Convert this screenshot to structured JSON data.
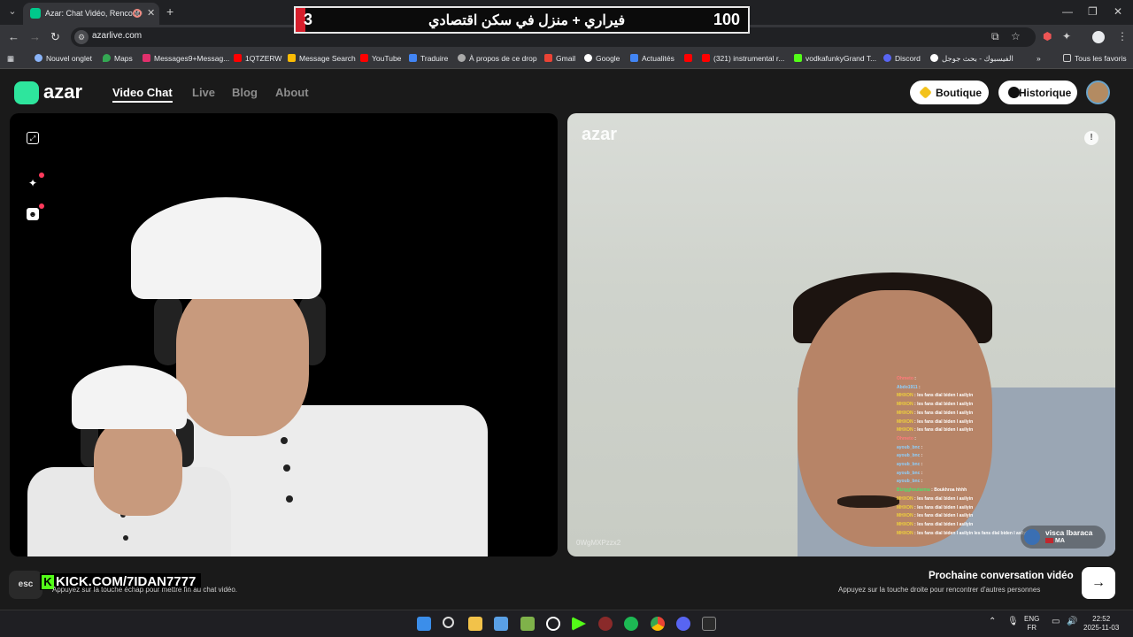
{
  "browser": {
    "tab_title": "Azar: Chat Vidéo, Rencontre",
    "url": "azarlive.com",
    "bookmarks": [
      "Nouvel onglet",
      "Maps",
      "Messages9+Messag...",
      "1QTZERW",
      "Message Search",
      "YouTube",
      "Traduire",
      "À propos de ce drop",
      "Gmail",
      "Google",
      "Actualités",
      "(321) instrumental r...",
      "vodkafunkyGrand T...",
      "Discord",
      "الفيسبوك - بحث جوجل"
    ],
    "all_bookmarks": "Tous les favoris"
  },
  "overlay": {
    "left_number": "3",
    "arabic_text": "فيراري + منزل في سكن اقتصادي",
    "right_number": "100"
  },
  "site": {
    "logo_text": "azar",
    "nav": [
      "Video Chat",
      "Live",
      "Blog",
      "About"
    ],
    "boutique_label": "Boutique",
    "historique_label": "Historique"
  },
  "remote_video": {
    "watermark": "azar",
    "user_id": "0WgMXPzzx2",
    "peer_name": "visca lbaraca",
    "peer_country": "MA"
  },
  "chat_overlay": [
    {
      "user": "Ohmeto",
      "msg": ""
    },
    {
      "user": "Abdo1911",
      "msg": ""
    },
    {
      "user": "MHXON",
      "msg": "les fans dial biden l asilyin"
    },
    {
      "user": "MHXON",
      "msg": "les fans dial biden l asilyin"
    },
    {
      "user": "MHXON",
      "msg": "les fans dial biden l asilyin"
    },
    {
      "user": "MHXON",
      "msg": "les fans dial biden l asilyin"
    },
    {
      "user": "MHXON",
      "msg": "les fans dial biden l asilyin"
    },
    {
      "user": "Ohmeto",
      "msg": ""
    },
    {
      "user": "ayoub_bnc",
      "msg": ""
    },
    {
      "user": "ayoub_bnc",
      "msg": ""
    },
    {
      "user": "ayoub_bnc",
      "msg": ""
    },
    {
      "user": "ayoub_bnc",
      "msg": ""
    },
    {
      "user": "ayoub_bnc",
      "msg": ""
    },
    {
      "user": "Bizigghoutarma",
      "msg": "Boukhroa hhhh"
    },
    {
      "user": "MHXON",
      "msg": "les fans dial biden l asilyin"
    },
    {
      "user": "MHXON",
      "msg": "les fans dial biden l asilyin"
    },
    {
      "user": "MHXON",
      "msg": "les fans dial biden l asilyin"
    },
    {
      "user": "MHXON",
      "msg": "les fans dial biden l asilyin"
    },
    {
      "user": "MHXON",
      "msg": "les fans dial biden l asilyin les fans dial biden l asilyin"
    }
  ],
  "footer": {
    "esc_label": "esc",
    "kick_text": "KICK.COM/7IDAN7777",
    "esc_hint": "Appuyez sur la touche échap pour mettre fin au chat vidéo.",
    "next_title": "Prochaine conversation vidéo",
    "next_sub": "Appuyez sur la touche droite pour rencontrer d'autres personnes"
  },
  "taskbar": {
    "lang_top": "ENG",
    "lang_bottom": "FR",
    "time": "22:52",
    "date": "2025-11-03"
  },
  "colors": {
    "azar_green": "#2ee59d",
    "kick_green": "#53fc18",
    "overlay_red": "#d61f2c"
  }
}
